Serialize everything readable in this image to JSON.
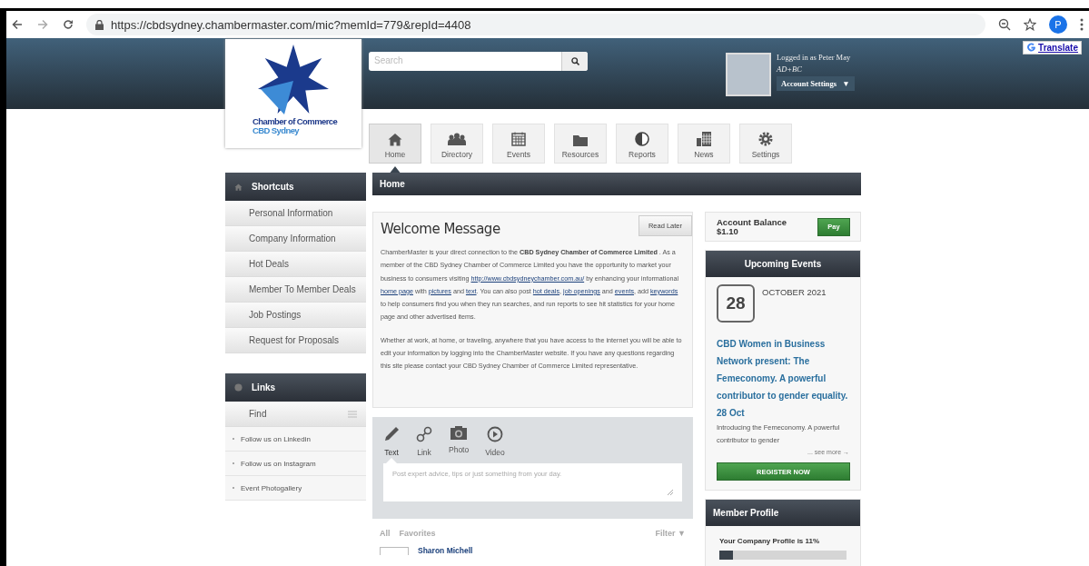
{
  "browser": {
    "url": "https://cbdsydney.chambermaster.com/mic?memId=779&repId=4408",
    "profile_initial": "P"
  },
  "header": {
    "logo_line1": "Chamber of Commerce",
    "logo_line2": "CBD Sydney",
    "search_placeholder": "Search",
    "logged_in": "Logged in as Peter May",
    "org": "AD+BC",
    "account_button": "Account Settings",
    "account_caret": "▼"
  },
  "translate": "Translate",
  "nav": [
    {
      "label": "Home",
      "selected": true
    },
    {
      "label": "Directory",
      "selected": false
    },
    {
      "label": "Events",
      "selected": false
    },
    {
      "label": "Resources",
      "selected": false
    },
    {
      "label": "Reports",
      "selected": false
    },
    {
      "label": "News",
      "selected": false
    },
    {
      "label": "Settings",
      "selected": false
    }
  ],
  "shortcuts": {
    "title": "Shortcuts",
    "items": [
      "Personal Information",
      "Company Information",
      "Hot Deals",
      "Member To Member Deals",
      "Job Postings",
      "Request for Proposals"
    ]
  },
  "links": {
    "title": "Links",
    "find": "Find",
    "items": [
      "Follow us on Linkedin",
      "Follow us on Instagram",
      "Event Photogallery"
    ]
  },
  "breadcrumb": "Home",
  "welcome": {
    "title": "Welcome Message",
    "button": "Read Later",
    "paragraphs": [
      [
        {
          "kind": "text",
          "text": "ChamberMaster is your direct connection to the "
        },
        {
          "kind": "bold",
          "text": "CBD Sydney Chamber of Commerce Limited"
        },
        {
          "kind": "text",
          "text": " .  As a member of the CBD Sydney Chamber of Commerce Limited you have the opportunity to market your business to consumers visiting "
        },
        {
          "kind": "link",
          "text": "http://www.cbdsydneychamber.com.au/"
        },
        {
          "kind": "text",
          "text": " by enhancing your informational "
        },
        {
          "kind": "link",
          "text": "home page"
        },
        {
          "kind": "text",
          "text": " with "
        },
        {
          "kind": "link",
          "text": "pictures"
        },
        {
          "kind": "text",
          "text": " and "
        },
        {
          "kind": "link",
          "text": "text"
        },
        {
          "kind": "text",
          "text": ".  You can also post "
        },
        {
          "kind": "link",
          "text": "hot deals"
        },
        {
          "kind": "text",
          "text": ", "
        },
        {
          "kind": "link",
          "text": "job openings"
        },
        {
          "kind": "text",
          "text": " and "
        },
        {
          "kind": "link",
          "text": "events"
        },
        {
          "kind": "text",
          "text": ", add "
        },
        {
          "kind": "link",
          "text": "keywords"
        },
        {
          "kind": "text",
          "text": " to help consumers find you when they run searches, and run reports to see hit statistics for your home page and other advertised items."
        }
      ],
      [
        {
          "kind": "text",
          "text": "Whether at work, at home, or traveling, anywhere that you have access to the internet you will be able to edit your information by logging into the ChamberMaster website.  If you have any questions regarding this site please contact your CBD Sydney Chamber of Commerce Limited representative."
        }
      ]
    ]
  },
  "composer": {
    "types": [
      {
        "label": "Text",
        "selected": true
      },
      {
        "label": "Link",
        "selected": false
      },
      {
        "label": "Photo",
        "selected": false
      },
      {
        "label": "Video",
        "selected": false
      }
    ],
    "placeholder": "Post expert advice, tips or just something from your day."
  },
  "feed": {
    "tabs": [
      "All",
      "Favorites"
    ],
    "filter": "Filter ▼",
    "post_author": "Sharon Michell"
  },
  "balance": {
    "label": "Account Balance",
    "amount": "$1.10",
    "button": "Pay"
  },
  "events": {
    "title": "Upcoming Events",
    "day": "28",
    "month": "OCTOBER 2021",
    "event_title": "CBD Women in Business Network present: The Femeconomy. A powerful contributor to gender equality.",
    "date": "28 Oct",
    "summary": "Introducing the Femeconomy. A powerful contributor to gender",
    "see_more": "... see more →",
    "button": "REGISTER NOW"
  },
  "profile": {
    "title": "Member Profile",
    "label": "Your Company Profile is 11%",
    "level": 0.11
  }
}
